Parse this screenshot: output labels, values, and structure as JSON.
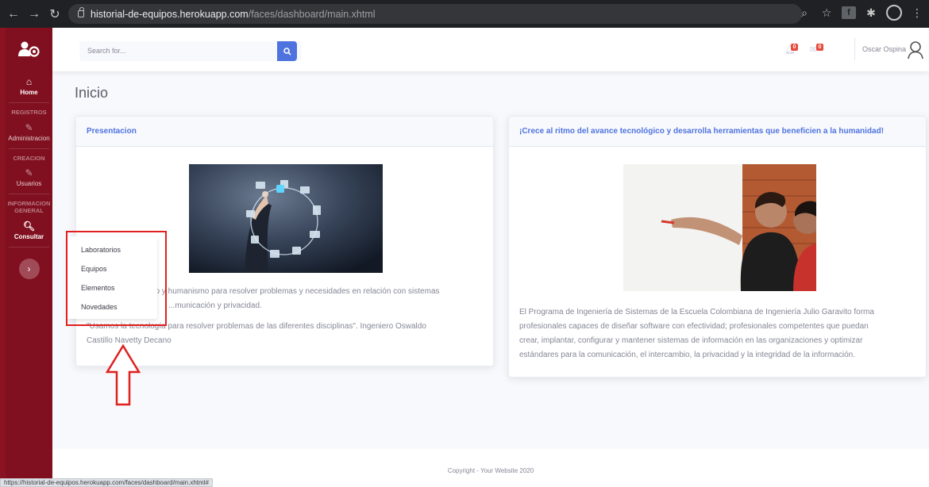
{
  "browser": {
    "url_host": "historial-de-equipos.herokuapp.com",
    "url_path": "/faces/dashboard/main.xhtml",
    "status_url": "https://historial-de-equipos.herokuapp.com/faces/dashboard/main.xhtml#"
  },
  "sidebar": {
    "items": [
      {
        "label": "Home",
        "icon": "home-icon"
      },
      {
        "heading": "REGISTROS"
      },
      {
        "label": "Administracion",
        "icon": "edit-icon"
      },
      {
        "heading": "CREACION"
      },
      {
        "label": "Usuarios",
        "icon": "edit-icon"
      },
      {
        "heading": "INFORMACION GENERAL"
      },
      {
        "label": "Consultar",
        "icon": "search-icon"
      }
    ]
  },
  "topbar": {
    "search_placeholder": "Search for...",
    "alerts_count": "0",
    "messages_count": "0",
    "user_name": "Oscar Ospina"
  },
  "page": {
    "title": "Inicio"
  },
  "card_left": {
    "header": "Presentacion",
    "text_1": "...ico y humanismo para resolver problemas y necesidades en relación con sistemas",
    "text_2": "...municación y privacidad.",
    "text_3": "\"Usamos la tecnología para resolver problemas de las diferentes disciplinas\". Ingeniero Oswaldo",
    "text_4": "Castillo Navetty Decano"
  },
  "card_right": {
    "header": "¡Crece al ritmo del avance tecnológico y desarrolla herramientas que beneficien a la humanidad!",
    "text_1": "El Programa de Ingeniería de Sistemas de la Escuela Colombiana de Ingeniería Julio Garavito forma",
    "text_2": "profesionales capaces de diseñar software con efectividad; profesionales competentes que puedan",
    "text_3": "crear, implantar, configurar y mantener sistemas de información en las organizaciones y optimizar",
    "text_4": "estándares para la comunicación, el intercambio, la privacidad y la integridad de la información."
  },
  "dropdown": {
    "items": [
      "Laboratorios",
      "Equipos",
      "Elementos",
      "Novedades"
    ]
  },
  "footer": {
    "copyright": "Copyright - Your Website 2020"
  },
  "colors": {
    "sidebar": "#800f1f",
    "primary": "#4e73df",
    "badge": "#e74a3b",
    "annotation": "#e0201f"
  }
}
